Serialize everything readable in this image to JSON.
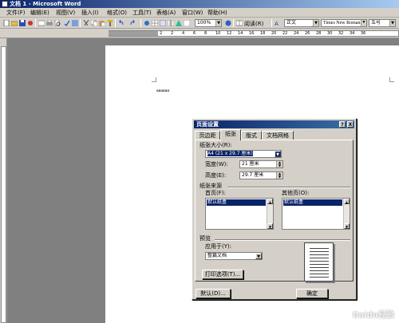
{
  "window": {
    "title": "文档 1 - Microsoft Word"
  },
  "menu": [
    "文件(F)",
    "编辑(E)",
    "视图(V)",
    "插入(I)",
    "格式(O)",
    "工具(T)",
    "表格(A)",
    "窗口(W)",
    "帮助(H)"
  ],
  "toolbar": {
    "zoom": "100%",
    "read_label": "阅读(R)",
    "style": "正文",
    "font": "Times New Roman",
    "size": "五号"
  },
  "ruler": {
    "h_numbers": [
      "2",
      "2",
      "4",
      "6",
      "8",
      "10",
      "12",
      "14",
      "16",
      "18",
      "20",
      "22",
      "24",
      "26",
      "28",
      "30",
      "32",
      "34",
      "36"
    ]
  },
  "document": {
    "text": "aaaaaa"
  },
  "dialog": {
    "title": "页面设置",
    "help": "?",
    "close": "X",
    "tabs": [
      "页边距",
      "纸张",
      "版式",
      "文档网格"
    ],
    "active_tab": "纸张",
    "paper_size_label": "纸张大小(R):",
    "paper_size_value": "A4 (21 x 29.7 厘米)",
    "width_label": "宽度(W):",
    "width_value": "21 厘米",
    "height_label": "高度(E):",
    "height_value": "29.7 厘米",
    "source_label": "纸张来源",
    "first_page_label": "首页(F):",
    "first_page_value": "默认纸盒",
    "other_pages_label": "其他页(O):",
    "other_pages_value": "默认纸盒",
    "preview_label": "预览",
    "apply_to_label": "应用于(Y):",
    "apply_to_value": "整篇文档",
    "print_options_label": "打印选项(T)...",
    "default_button": "默认(D)...",
    "ok_button": "确定"
  },
  "watermark": "Baidu经验"
}
